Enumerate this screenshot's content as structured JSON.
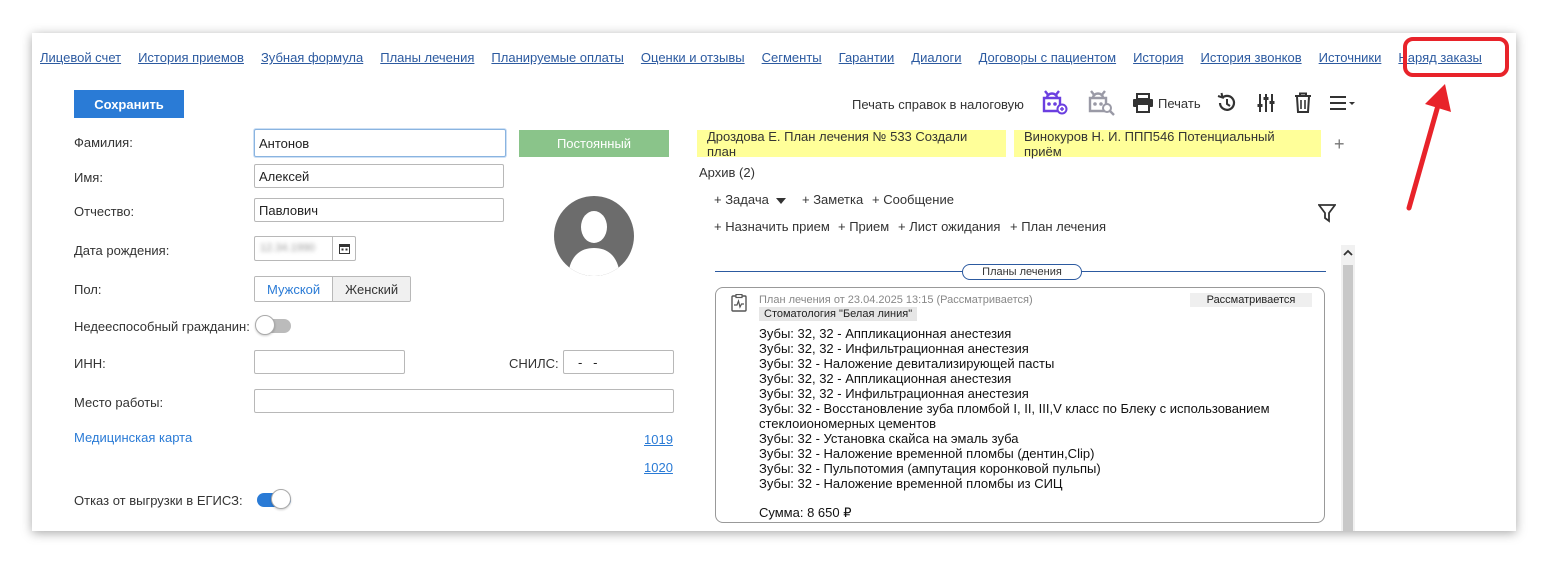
{
  "nav": {
    "items": [
      "Лицевой счет",
      "История приемов",
      "Зубная формула",
      "Планы лечения",
      "Планируемые оплаты",
      "Оценки и отзывы",
      "Сегменты",
      "Гарантии",
      "Диалоги",
      "Договоры с пациентом",
      "История",
      "История звонков",
      "Источники",
      "Наряд заказы"
    ]
  },
  "form": {
    "save_label": "Сохранить",
    "surname_label": "Фамилия:",
    "surname_value": "Антонов",
    "name_label": "Имя:",
    "name_value": "Алексей",
    "patronymic_label": "Отчество:",
    "patronymic_value": "Павлович",
    "birthdate_label": "Дата рождения:",
    "birthdate_value": "12.34.1990",
    "gender_label": "Пол:",
    "gender_male": "Мужской",
    "gender_female": "Женский",
    "incapable_label": "Недееспособный гражданин:",
    "inn_label": "ИНН:",
    "snils_label": "СНИЛС:",
    "snils_value": "-   -",
    "work_label": "Место работы:",
    "medcard_label": "Медицинская карта",
    "medcard_1": "1019",
    "medcard_2": "1020",
    "egisz_label": "Отказ от выгрузки в ЕГИСЗ:",
    "status_label": "Постоянный"
  },
  "toolbar": {
    "tax_print": "Печать справок в налоговую",
    "print_label": "Печать"
  },
  "plan_tabs": [
    "Дроздова Е. План лечения № 533  Создали план",
    "Винокуров Н. И. ППП546  Потенциальный приём"
  ],
  "archive_label": "Архив (2)",
  "actions": {
    "task": "+ Задача",
    "note": "+ Заметка",
    "message": "+ Сообщение",
    "appoint": "+ Назначить прием",
    "reception": "+ Прием",
    "waitlist": "+ Лист ожидания",
    "plan": "+ План лечения"
  },
  "section_title": "Планы лечения",
  "plan_card": {
    "header": "План лечения от 23.04.2025 13:15 (Рассматривается)",
    "status": "Рассматривается",
    "clinic": "Стоматология \"Белая линия\"",
    "lines": [
      "Зубы: 32, 32 - Аппликационная анестезия",
      "Зубы: 32, 32 - Инфильтрационная анестезия",
      "Зубы: 32 - Наложение девитализирующей пасты",
      "Зубы: 32, 32 - Аппликационная анестезия",
      "Зубы: 32, 32 - Инфильтрационная анестезия",
      "Зубы: 32 - Восстановление зуба пломбой I, II, III,V класс по Блеку с использованием стеклоиономерных цементов",
      "Зубы: 32 - Установка скайса на эмаль зуба",
      "Зубы: 32 - Наложение временной пломбы (дентин,Clip)",
      "Зубы: 32 - Пульпотомия (ампутация коронковой пульпы)",
      "Зубы: 32 - Наложение временной пломбы  из СИЦ"
    ],
    "sum": "Сумма: 8 650 ₽"
  },
  "colors": {
    "accent": "#2a7bd6",
    "status_green": "#8ac48a",
    "tab_yellow": "#ffff99",
    "annotation_red": "#e8232a"
  }
}
